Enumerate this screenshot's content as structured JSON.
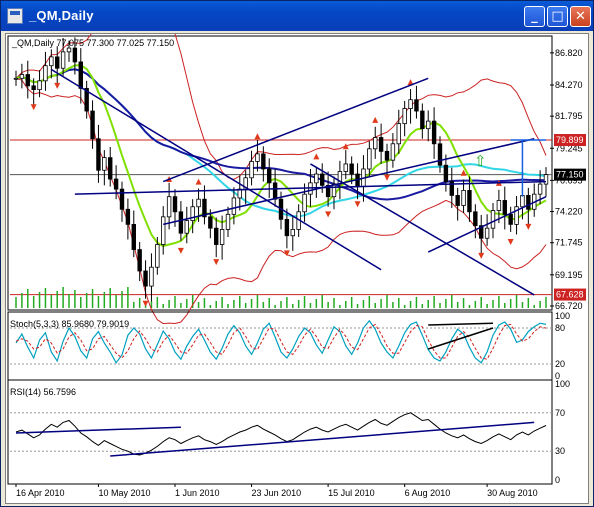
{
  "window": {
    "title": "_QM,Daily",
    "minimize_glyph": "_",
    "maximize_glyph": "□",
    "close_glyph": "✕"
  },
  "colors": {
    "background": "#ffffff",
    "candles": "#000000",
    "trendlines": "#000080",
    "bollinger": "#cc2222",
    "ma_cyan": "#33d6e6",
    "ma_green": "#80e000",
    "ma_navy": "#1a1aa0",
    "fractals": "#e03a1a",
    "volume": "#22aa22",
    "stoch_main": "#00a0c0",
    "stoch_signal": "#d02020",
    "rsi": "#000000",
    "current_price_tag": "#000000",
    "resistance_tag": "#cc2222"
  },
  "chart_data": [
    {
      "type": "candlestick",
      "title": "_QM,Daily",
      "ohlc_label": "_QM,Daily  77.075 77.300 77.025 77.150",
      "ylim": [
        66.72,
        88.0
      ],
      "yticks": [
        "86.820",
        "84.270",
        "81.795",
        "79.245",
        "76.695",
        "74.220",
        "71.745",
        "69.195",
        "66.720"
      ],
      "price_tags": [
        {
          "label": "79.899",
          "value": 79.899,
          "kind": "resistance"
        },
        {
          "label": "77.150",
          "value": 77.15,
          "kind": "current"
        },
        {
          "label": "67.628",
          "value": 67.628,
          "kind": "support"
        }
      ],
      "x_labels": [
        "16 Apr 2010",
        "10 May 2010",
        "1 Jun 2010",
        "23 Jun 2010",
        "15 Jul 2010",
        "6 Aug 2010",
        "30 Aug 2010"
      ],
      "close_series": [
        84.8,
        85.1,
        84.2,
        83.9,
        84.6,
        85.8,
        86.5,
        85.6,
        86.9,
        87.2,
        86.1,
        84.0,
        82.2,
        80.0,
        77.5,
        78.5,
        76.8,
        76.0,
        74.4,
        73.2,
        71.2,
        69.5,
        68.3,
        69.8,
        71.6,
        73.8,
        75.4,
        74.2,
        72.5,
        73.5,
        74.6,
        75.2,
        73.8,
        72.9,
        71.6,
        72.8,
        74.0,
        75.3,
        76.0,
        76.9,
        78.2,
        78.8,
        77.6,
        76.5,
        75.2,
        73.6,
        72.3,
        72.8,
        74.2,
        75.6,
        76.5,
        77.2,
        76.3,
        75.4,
        76.4,
        77.4,
        78.0,
        77.2,
        76.2,
        77.6,
        79.2,
        80.1,
        79.0,
        78.3,
        79.6,
        81.2,
        82.4,
        83.1,
        82.2,
        80.8,
        81.4,
        79.6,
        77.9,
        76.6,
        75.5,
        74.7,
        75.9,
        74.2,
        73.1,
        72.1,
        72.9,
        74.3,
        75.1,
        74.0,
        73.2,
        74.6,
        75.5,
        74.4,
        75.6,
        76.4,
        77.15
      ]
    },
    {
      "type": "line",
      "title": "Stoch(5,3,3) 85.9680 79.9019",
      "ylim": [
        0,
        100
      ],
      "yticks": [
        "100",
        "80",
        "20",
        "0"
      ],
      "series": [
        {
          "name": "Stoch %K",
          "values": [
            55,
            70,
            48,
            30,
            60,
            72,
            40,
            25,
            58,
            80,
            66,
            42,
            30,
            62,
            74,
            55,
            40,
            22,
            35,
            68,
            80,
            70,
            45,
            30,
            52,
            75,
            62,
            40,
            28,
            50,
            66,
            78,
            60,
            40,
            28,
            46,
            70,
            84,
            72,
            50,
            36,
            55,
            78,
            88,
            65,
            40,
            30,
            45,
            66,
            80,
            72,
            52,
            38,
            60,
            82,
            74,
            50,
            36,
            55,
            80,
            92,
            78,
            55,
            40,
            30,
            50,
            72,
            86,
            90,
            68,
            44,
            30,
            25,
            40,
            62,
            78,
            70,
            48,
            30,
            22,
            40,
            68,
            85,
            90,
            78,
            56,
            60,
            74,
            82,
            88,
            85.968
          ]
        },
        {
          "name": "Stoch %D",
          "values": [
            58,
            62,
            58,
            45,
            48,
            62,
            55,
            38,
            45,
            65,
            72,
            60,
            42,
            45,
            62,
            66,
            52,
            38,
            30,
            42,
            62,
            75,
            62,
            45,
            40,
            58,
            68,
            55,
            40,
            38,
            52,
            68,
            70,
            56,
            40,
            36,
            52,
            72,
            80,
            66,
            48,
            44,
            62,
            80,
            78,
            58,
            40,
            36,
            50,
            68,
            78,
            66,
            48,
            46,
            64,
            78,
            66,
            48,
            44,
            62,
            80,
            86,
            70,
            50,
            38,
            38,
            56,
            74,
            84,
            82,
            60,
            42,
            30,
            30,
            48,
            66,
            74,
            64,
            46,
            30,
            28,
            46,
            68,
            84,
            86,
            70,
            58,
            62,
            74,
            82,
            79.902
          ]
        }
      ]
    },
    {
      "type": "line",
      "title": "RSI(14) 56.7596",
      "ylim": [
        0,
        100
      ],
      "yticks": [
        "100",
        "70",
        "30",
        "0"
      ],
      "series": [
        {
          "name": "RSI(14)",
          "values": [
            50,
            52,
            48,
            44,
            47,
            53,
            58,
            55,
            60,
            62,
            56,
            49,
            45,
            40,
            36,
            41,
            38,
            35,
            32,
            30,
            27,
            26,
            28,
            31,
            35,
            40,
            44,
            42,
            38,
            41,
            44,
            46,
            42,
            40,
            37,
            40,
            44,
            47,
            50,
            52,
            55,
            57,
            53,
            50,
            47,
            43,
            40,
            42,
            46,
            50,
            53,
            55,
            52,
            50,
            53,
            56,
            58,
            55,
            52,
            56,
            60,
            63,
            59,
            57,
            61,
            65,
            68,
            70,
            66,
            62,
            63,
            58,
            53,
            49,
            46,
            44,
            47,
            43,
            40,
            38,
            41,
            45,
            48,
            45,
            42,
            47,
            50,
            47,
            51,
            54,
            56.76
          ]
        }
      ]
    }
  ],
  "annotations": {
    "up_arrow_glyph": "⇧"
  }
}
